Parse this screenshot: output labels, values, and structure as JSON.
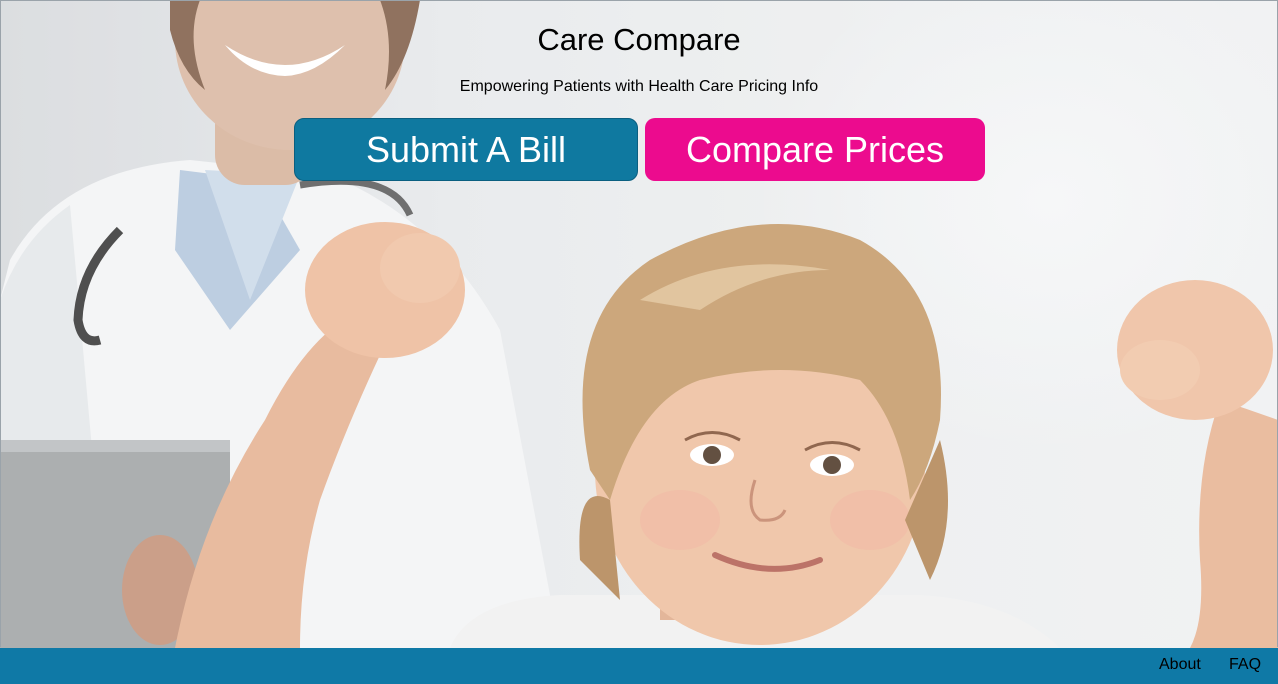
{
  "header": {
    "title": "Care Compare",
    "subtitle": "Empowering Patients with Health Care Pricing Info"
  },
  "actions": {
    "submit_bill": "Submit A Bill",
    "compare_prices": "Compare Prices"
  },
  "footer": {
    "about": "About",
    "faq": "FAQ"
  },
  "colors": {
    "submit_button": "#0f79a0",
    "compare_button": "#ec0b8e",
    "footer_bar": "#0f79a6"
  }
}
